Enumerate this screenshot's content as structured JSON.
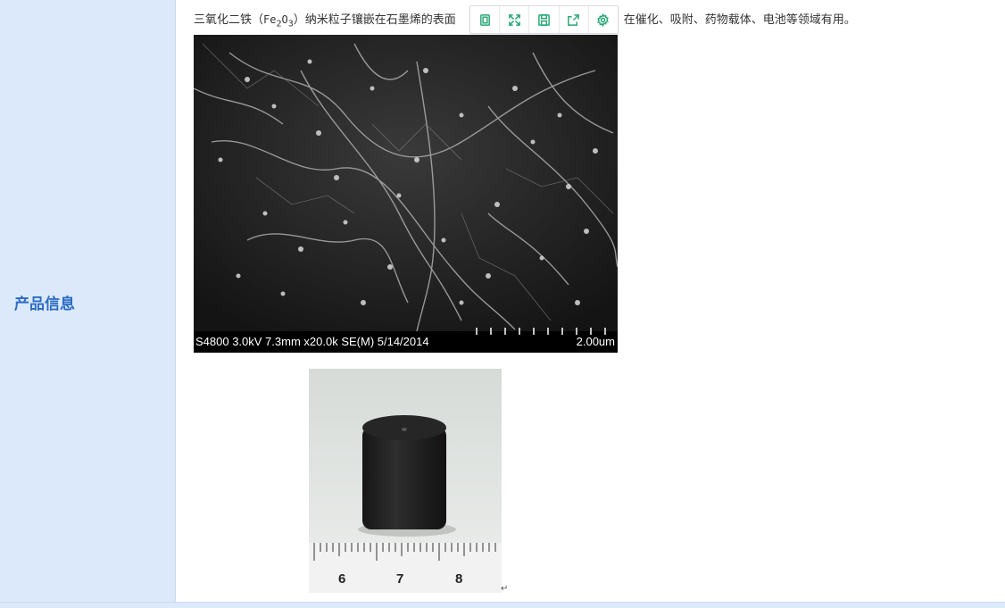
{
  "sidebar": {
    "label": "产品信息"
  },
  "description": {
    "prefix": "三氧化二铁（",
    "formula_main": "Fe",
    "formula_sub1": "2",
    "formula_mid": "O",
    "formula_sub2": "3",
    "after_formula": "）纳米粒子镶嵌在石墨烯的表面",
    "suffix": "构，在催化、吸附、药物载体、电池等领域有用。"
  },
  "toolbar": {
    "buttons": [
      {
        "icon": "copy-icon"
      },
      {
        "icon": "expand-icon"
      },
      {
        "icon": "save-icon"
      },
      {
        "icon": "share-icon"
      },
      {
        "icon": "settings-icon"
      }
    ],
    "accent": "#2aa876"
  },
  "sem_image": {
    "caption_left": "S4800 3.0kV 7.3mm x20.0k SE(M) 5/14/2014",
    "caption_right": "2.00um"
  },
  "photo": {
    "ruler_numbers": [
      "6",
      "7",
      "8"
    ]
  },
  "colors": {
    "sidebar_bg": "#dce9fb",
    "sidebar_text": "#2b6cc4"
  }
}
